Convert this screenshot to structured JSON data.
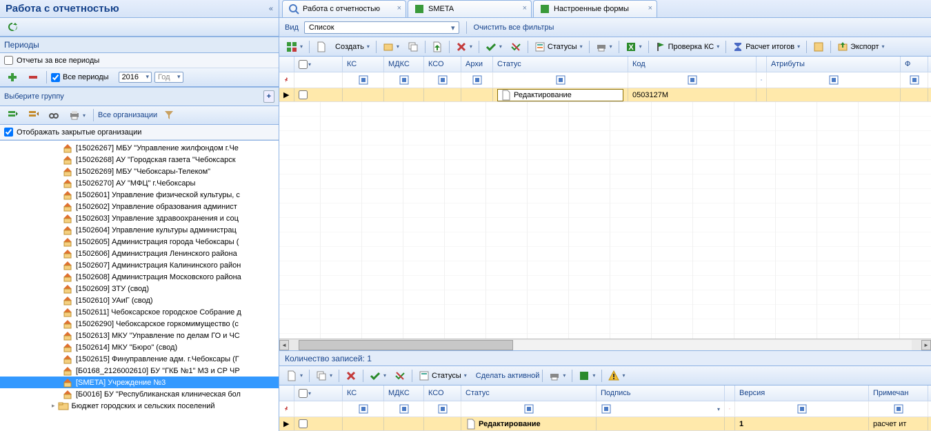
{
  "sidebar": {
    "title": "Работа с отчетностью",
    "periods_label": "Периоды",
    "all_periods_reports": "Отчеты за все периоды",
    "all_periods_check": "Все периоды",
    "year": "2016",
    "god_label": "Год",
    "select_group": "Выберите группу",
    "all_orgs": "Все организации",
    "show_closed": "Отображать закрытые организации"
  },
  "tree": [
    {
      "code": "[15026267]",
      "name": "МБУ \"Управление жилфондом г.Че"
    },
    {
      "code": "[15026268]",
      "name": "АУ \"Городская газета \"Чебоксарск"
    },
    {
      "code": "[15026269]",
      "name": "МБУ \"Чебоксары-Телеком\""
    },
    {
      "code": "[15026270]",
      "name": "АУ \"МФЦ\" г.Чебоксары"
    },
    {
      "code": "[1502601]",
      "name": "Управление физической культуры, с"
    },
    {
      "code": "[1502602]",
      "name": "Управление образования админист"
    },
    {
      "code": "[1502603]",
      "name": "Управление здравоохранения и соц"
    },
    {
      "code": "[1502604]",
      "name": "Управление культуры администрац"
    },
    {
      "code": "[1502605]",
      "name": "Администрация города Чебоксары ("
    },
    {
      "code": "[1502606]",
      "name": "Администрация Ленинского района"
    },
    {
      "code": "[1502607]",
      "name": "Администрация Калининского район"
    },
    {
      "code": "[1502608]",
      "name": "Администрация Московского района"
    },
    {
      "code": "[1502609]",
      "name": "ЗТУ (свод)"
    },
    {
      "code": "[1502610]",
      "name": "УАиГ (свод)"
    },
    {
      "code": "[1502611]",
      "name": "Чебоксарское городское Собрание д"
    },
    {
      "code": "[15026290]",
      "name": "Чебоксарское горкомимущество (с"
    },
    {
      "code": "[1502613]",
      "name": "МКУ \"Управление по делам ГО и ЧС"
    },
    {
      "code": "[1502614]",
      "name": "МКУ \"Бюро\" (свод)"
    },
    {
      "code": "[1502615]",
      "name": "Финуправление адм. г.Чебоксары (Г"
    },
    {
      "code": "[Б0168_2126002610]",
      "name": "БУ \"ГКБ №1\" МЗ и СР ЧР"
    },
    {
      "code": "[SMETA]",
      "name": "Учреждение №3",
      "selected": true
    },
    {
      "code": "[Б0016]",
      "name": "БУ \"Республиканская клиническая бол"
    }
  ],
  "tree_folder": "Бюджет городских и сельских поселений",
  "tabs": [
    {
      "label": "Работа с отчетностью"
    },
    {
      "label": "SMETA"
    },
    {
      "label": "Настроенные формы"
    }
  ],
  "view": {
    "label": "Вид",
    "value": "Список",
    "clear": "Очистить все фильтры"
  },
  "toolbar_main": {
    "create": "Создать",
    "statuses": "Статусы",
    "check": "Проверка КС",
    "calc": "Расчет итогов",
    "export": "Экспорт"
  },
  "grid1": {
    "cols": [
      "",
      "",
      "КС",
      "МДКС",
      "КСО",
      "Архи",
      "Статус",
      "Код",
      "",
      "Атрибуты",
      "Ф"
    ],
    "row": {
      "status": "Редактирование",
      "code": "0503127М"
    }
  },
  "record_count": "Количество записей: 1",
  "toolbar2": {
    "statuses": "Статусы",
    "make_active": "Сделать активной"
  },
  "grid2": {
    "cols": [
      "",
      "",
      "КС",
      "МДКС",
      "КСО",
      "Статус",
      "Подпись",
      "",
      "Версия",
      "Примечан"
    ],
    "row": {
      "status": "Редактирование",
      "version": "1",
      "note": "расчет ит"
    }
  }
}
